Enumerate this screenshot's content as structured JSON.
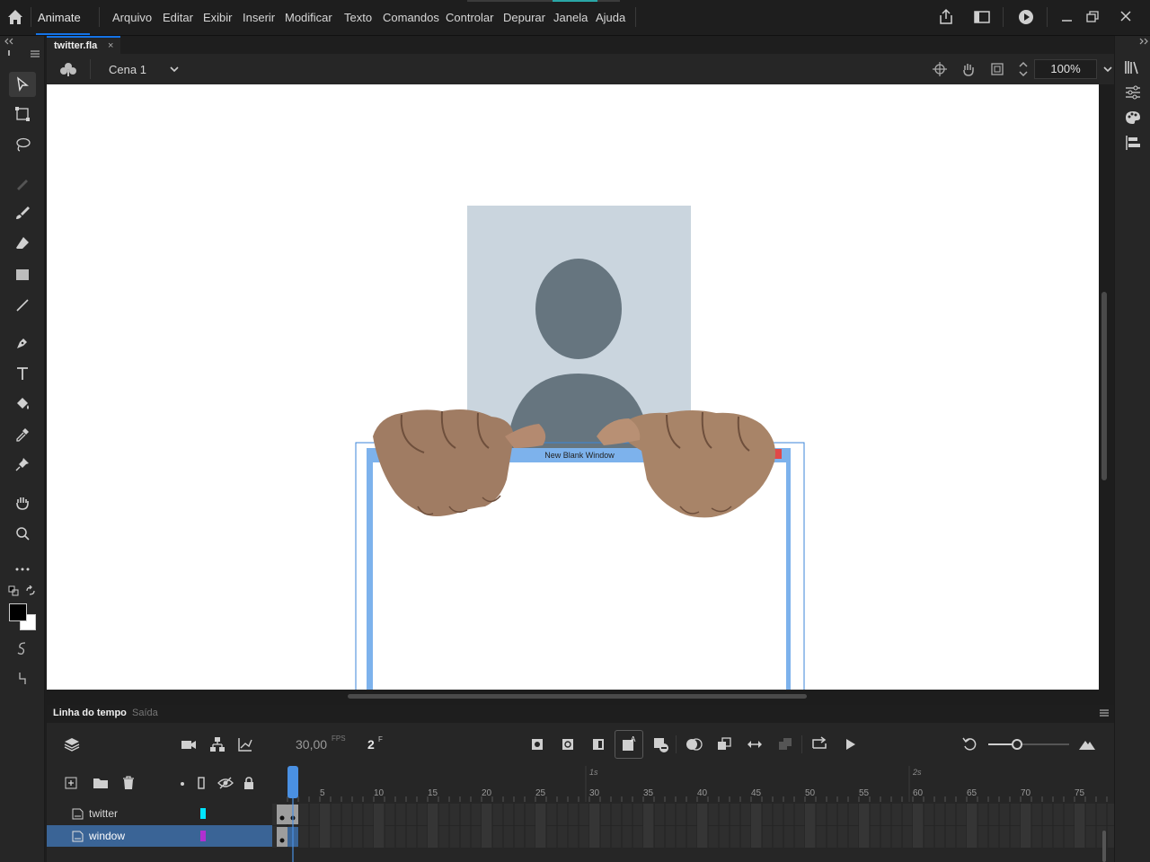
{
  "app": {
    "name": "Animate",
    "menus": [
      "Arquivo",
      "Editar",
      "Exibir",
      "Inserir",
      "Modificar",
      "Texto",
      "Comandos",
      "Controlar",
      "Depurar",
      "Janela",
      "Ajuda"
    ]
  },
  "document": {
    "tab_name": "twitter.fla",
    "tab_close": "×",
    "scene": "Cena 1",
    "zoom": "100%"
  },
  "stage": {
    "window_title": "New Blank Window"
  },
  "timeline": {
    "tab_timeline": "Linha do tempo",
    "tab_output": "Saída",
    "fps": "30,00",
    "fps_unit": "FPS",
    "current_frame": "2",
    "frame_unit": "F",
    "ruler_numbers": [
      "5",
      "10",
      "15",
      "20",
      "25",
      "30",
      "35",
      "40",
      "45",
      "50",
      "55",
      "60",
      "65",
      "70",
      "75"
    ],
    "second_markers": [
      "1s",
      "2s"
    ],
    "layers": [
      {
        "name": "twitter",
        "color": "#00e5ff",
        "selected": false
      },
      {
        "name": "window",
        "color": "#b030d0",
        "selected": true
      }
    ]
  },
  "colors": {
    "accent": "#1473e6",
    "selection": "#3a6496",
    "playhead": "#4a90e2"
  }
}
